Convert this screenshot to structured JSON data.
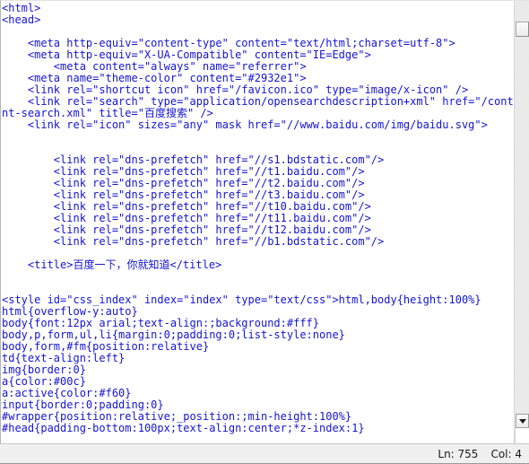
{
  "window": {
    "type": "source-code-viewer",
    "text_color": "#1414d2",
    "background_color": "#ffffff"
  },
  "source": {
    "language": "html",
    "lines": [
      "<html>",
      "<head>",
      "",
      "    <meta http-equiv=\"content-type\" content=\"text/html;charset=utf-8\">",
      "    <meta http-equiv=\"X-UA-Compatible\" content=\"IE=Edge\">",
      "        <meta content=\"always\" name=\"referrer\">",
      "    <meta name=\"theme-color\" content=\"#2932e1\">",
      "    <link rel=\"shortcut icon\" href=\"/favicon.ico\" type=\"image/x-icon\" />",
      "    <link rel=\"search\" type=\"application/opensearchdescription+xml\" href=\"/conte",
      "nt-search.xml\" title=\"百度搜索\" />",
      "    <link rel=\"icon\" sizes=\"any\" mask href=\"//www.baidu.com/img/baidu.svg\">",
      "",
      "",
      "        <link rel=\"dns-prefetch\" href=\"//s1.bdstatic.com\"/>",
      "        <link rel=\"dns-prefetch\" href=\"//t1.baidu.com\"/>",
      "        <link rel=\"dns-prefetch\" href=\"//t2.baidu.com\"/>",
      "        <link rel=\"dns-prefetch\" href=\"//t3.baidu.com\"/>",
      "        <link rel=\"dns-prefetch\" href=\"//t10.baidu.com\"/>",
      "        <link rel=\"dns-prefetch\" href=\"//t11.baidu.com\"/>",
      "        <link rel=\"dns-prefetch\" href=\"//t12.baidu.com\"/>",
      "        <link rel=\"dns-prefetch\" href=\"//b1.bdstatic.com\"/>",
      "",
      "    <title>百度一下，你就知道</title>",
      "",
      "",
      "<style id=\"css_index\" index=\"index\" type=\"text/css\">html,body{height:100%}",
      "html{overflow-y:auto}",
      "body{font:12px arial;text-align:;background:#fff}",
      "body,p,form,ul,li{margin:0;padding:0;list-style:none}",
      "body,form,#fm{position:relative}",
      "td{text-align:left}",
      "img{border:0}",
      "a{color:#00c}",
      "a:active{color:#f60}",
      "input{border:0;padding:0}",
      "#wrapper{position:relative;_position:;min-height:100%}",
      "#head{padding-bottom:100px;text-align:center;*z-index:1}"
    ]
  },
  "scrollbar": {
    "orientation": "vertical",
    "thumb_position": "near-top",
    "down_arrow_glyph": "▼"
  },
  "status_bar": {
    "line_label": "Ln: 755",
    "column_label": "Col: 4"
  }
}
